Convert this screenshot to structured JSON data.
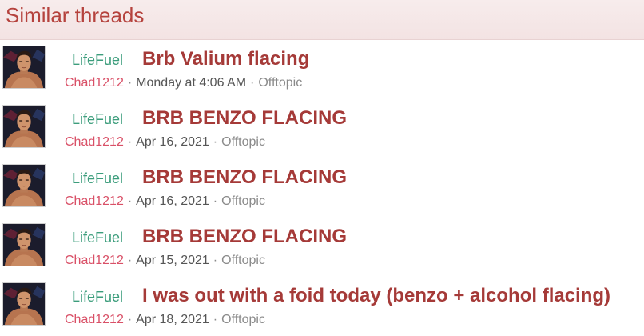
{
  "header": {
    "title": "Similar threads"
  },
  "threads": [
    {
      "prefix": "LifeFuel",
      "title": "Brb Valium flacing",
      "user": "Chad1212",
      "date": "Monday at 4:06 AM",
      "forum": "Offtopic"
    },
    {
      "prefix": "LifeFuel",
      "title": "BRB BENZO FLACING",
      "user": "Chad1212",
      "date": "Apr 16, 2021",
      "forum": "Offtopic"
    },
    {
      "prefix": "LifeFuel",
      "title": "BRB BENZO FLACING",
      "user": "Chad1212",
      "date": "Apr 16, 2021",
      "forum": "Offtopic"
    },
    {
      "prefix": "LifeFuel",
      "title": "BRB BENZO FLACING",
      "user": "Chad1212",
      "date": "Apr 15, 2021",
      "forum": "Offtopic"
    },
    {
      "prefix": "LifeFuel",
      "title": "I was out with a foid today (benzo + alcohol flacing)",
      "user": "Chad1212",
      "date": "Apr 18, 2021",
      "forum": "Offtopic"
    }
  ],
  "meta_separator": "·",
  "colors": {
    "header_text": "#b5423d",
    "title": "#a53a38",
    "prefix": "#3c9d7c",
    "username": "#d95067"
  }
}
